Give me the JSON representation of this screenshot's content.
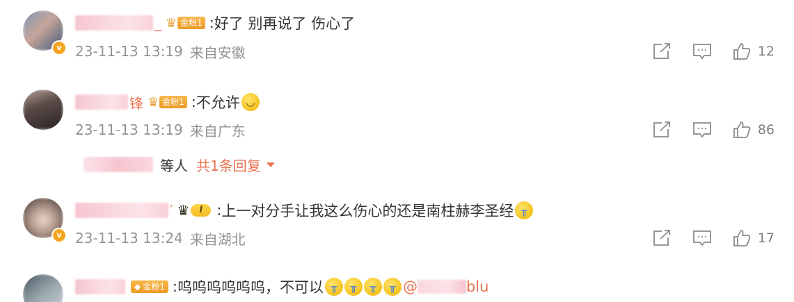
{
  "colors": {
    "accent": "#eb7350",
    "meta_text": "#939393",
    "body_text": "#333333",
    "badge_gold": "#f0a030",
    "verified_orange": "#f6a623"
  },
  "comments": [
    {
      "username_tail": "_",
      "badge_label": "金粉1",
      "badge_icon": "crown-icon",
      "colon": ":",
      "text": "好了 别再说了 伤心了",
      "emojis": [],
      "time": "23-11-13 13:19",
      "location": "来自安徽",
      "verified": true,
      "likes": "12",
      "avatar_colors": [
        "#6d8aa8",
        "#c7a59a",
        "#3e5a78"
      ]
    },
    {
      "username_tail": "锋",
      "badge_label": "金粉1",
      "badge_icon": "crown-icon",
      "colon": ":",
      "text": "不允许",
      "emojis": [
        "smile-emoji"
      ],
      "time": "23-11-13 13:19",
      "location": "来自广东",
      "verified": false,
      "likes": "86",
      "avatar_colors": [
        "#5a4b48",
        "#d3b8ae",
        "#2a2322"
      ],
      "replies": {
        "who_suffix": "等人",
        "link": "共1条回复"
      }
    },
    {
      "username_tail": "′",
      "badge_label": "I",
      "badge_icon": "vip-crown-icon",
      "colon": ":",
      "text": "上一对分手让我这么伤心的还是南柱赫李圣经",
      "emojis": [
        "cry-emoji"
      ],
      "time": "23-11-13 13:24",
      "location": "来自湖北",
      "verified": true,
      "likes": "17",
      "avatar_colors": [
        "#6b5a52",
        "#e0c8bc",
        "#3c302b"
      ]
    },
    {
      "username_tail": "",
      "badge_label": "金粉1",
      "badge_icon": "fan-badge-icon",
      "colon": ":",
      "text": "呜呜呜呜呜呜，不可以",
      "emojis": [
        "cry-emoji",
        "cry-emoji",
        "cry-emoji",
        "cry-emoji"
      ],
      "mention_prefix": "@",
      "mention_tail": "blu",
      "time": "",
      "location": "",
      "verified": false,
      "likes": "",
      "avatar_colors": [
        "#7c8b95",
        "#cfd8dc",
        "#4a5a63"
      ]
    }
  ]
}
